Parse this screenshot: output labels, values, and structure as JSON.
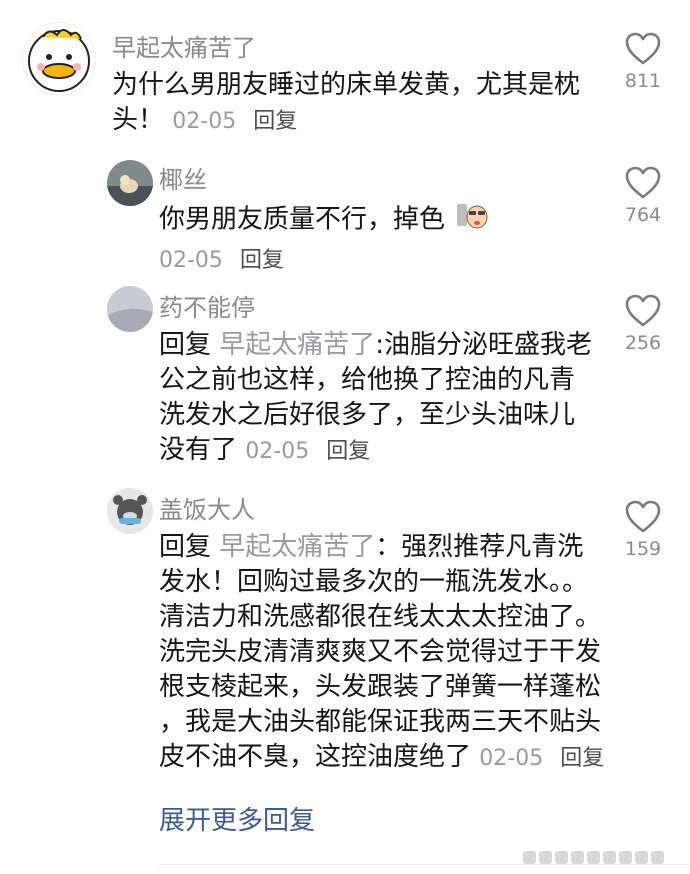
{
  "comments": [
    {
      "author": "早起太痛苦了",
      "lines": [
        "为什么男朋友睡过的床单发黄，尤其是枕",
        "头！"
      ],
      "date": "02-05",
      "reply": "回复",
      "likes": "811",
      "avatar": "duck-avatar"
    },
    {
      "author": "椰丝",
      "lines": [
        "你男朋友质量不行，掉色"
      ],
      "date": "02-05",
      "reply": "回复",
      "likes": "764",
      "avatar": "dog-avatar",
      "emoji": "sticker-emoji"
    },
    {
      "author": "药不能停",
      "reply_prefix": "回复 ",
      "reply_target": "早起太痛苦了",
      "lines": [
        ":油脂分泌旺盛我老",
        "公之前也这样，给他换了控油的凡青",
        "洗发水之后好很多了，至少头油味儿",
        "没有了"
      ],
      "date": "02-05",
      "reply": "回复",
      "likes": "256",
      "avatar": "gray-avatar"
    },
    {
      "author": "盖饭大人",
      "reply_prefix": "回复 ",
      "reply_target": "早起太痛苦了",
      "lines": [
        "：强烈推荐凡青洗",
        "发水！回购过最多次的一瓶洗发水。。",
        "清洁力和洗感都很在线太太太控油了。",
        "洗完头皮清清爽爽又不会觉得过于干发",
        "根支棱起来，头发跟装了弹簧一样蓬松",
        "，我是大油头都能保证我两三天不贴头",
        "皮不油不臭，这控油度绝了"
      ],
      "date": "02-05",
      "reply": "回复",
      "likes": "159",
      "avatar": "cartoon-avatar"
    }
  ],
  "expand_more": "展开更多回复"
}
